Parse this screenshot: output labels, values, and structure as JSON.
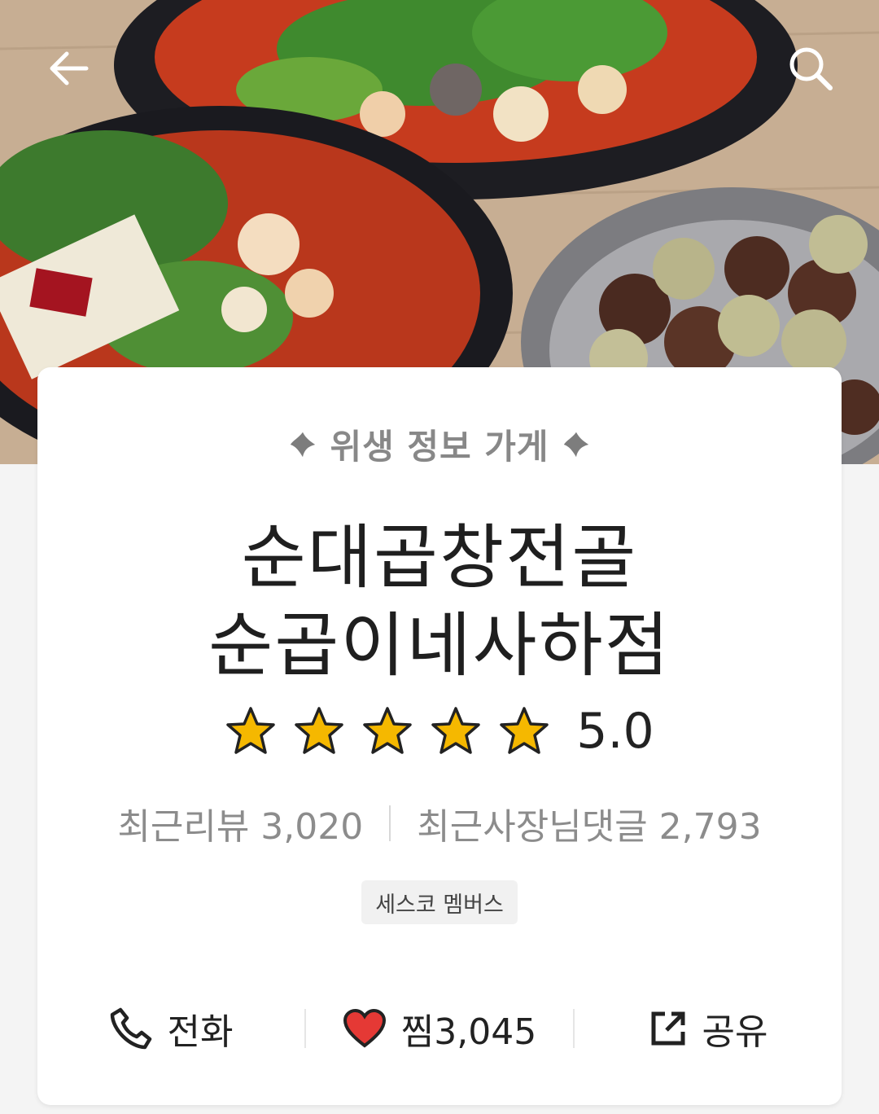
{
  "header": {
    "back_icon": "arrow-left-icon",
    "search_icon": "search-icon"
  },
  "store": {
    "hygiene_label": "위생 정보 가게",
    "name_line1": "순대곱창전골",
    "name_line2": "순곱이네사하점",
    "rating": 5.0,
    "rating_text": "5.0",
    "stars_filled": 5,
    "stars_total": 5
  },
  "stats": {
    "recent_reviews_label": "최근리뷰 3,020",
    "recent_owner_replies_label": "최근사장님댓글 2,793"
  },
  "badge": {
    "label": "세스코 멤버스"
  },
  "actions": {
    "call_label": "전화",
    "favorite_label": "찜3,045",
    "share_label": "공유",
    "call_icon": "phone-icon",
    "favorite_icon": "heart-icon",
    "share_icon": "share-icon"
  },
  "colors": {
    "heart": "#e53935",
    "star": "#f5b800",
    "hygiene_text": "#888888"
  }
}
